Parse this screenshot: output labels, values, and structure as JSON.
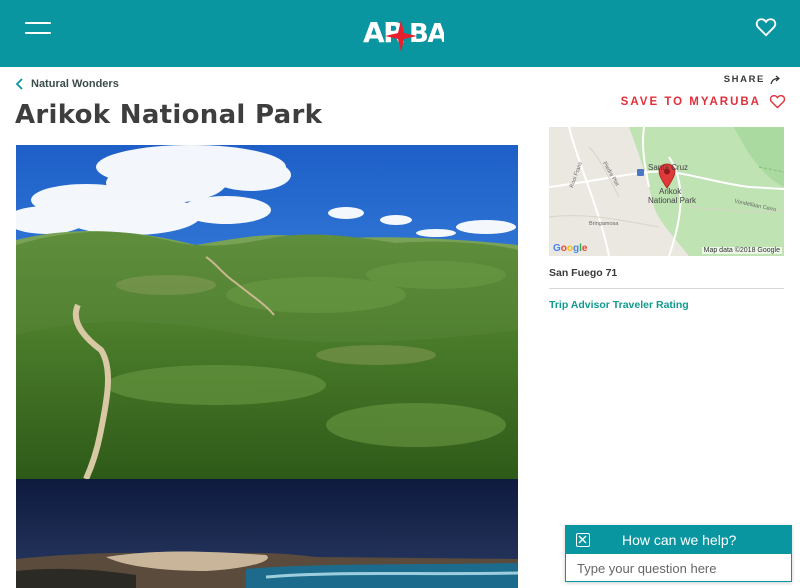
{
  "header": {
    "logo_text": "ARUBA",
    "bg_color": "#0a96a0",
    "menu_icon": "hamburger-menu-icon",
    "favorites_icon": "heart-outline-icon"
  },
  "breadcrumb": {
    "label": "Natural Wonders",
    "icon": "chevron-left-icon"
  },
  "actions": {
    "share_label": "SHARE",
    "save_label": "SAVE TO MYARUBA",
    "save_color": "#e0303c"
  },
  "page": {
    "title": "Arikok National Park"
  },
  "map": {
    "town_label": "Santa Cruz",
    "park_label_line1": "Arikok",
    "park_label_line2": "National Park",
    "provider": "Google",
    "attribution": "Map data ©2018 Google",
    "road_label_1": "Rooi Frans",
    "road_label_2": "Piedra Plat",
    "road_label_3": "Bringamosa",
    "road_label_4": "Vondellaan Cerro",
    "marker_icon": "map-pin-icon"
  },
  "details": {
    "address": "San Fuego 71",
    "rating_link": "Trip Advisor Traveler Rating",
    "rating_color": "#0f9a8e"
  },
  "chat": {
    "title": "How can we help?",
    "placeholder": "Type your question here",
    "close_icon": "close-icon"
  }
}
